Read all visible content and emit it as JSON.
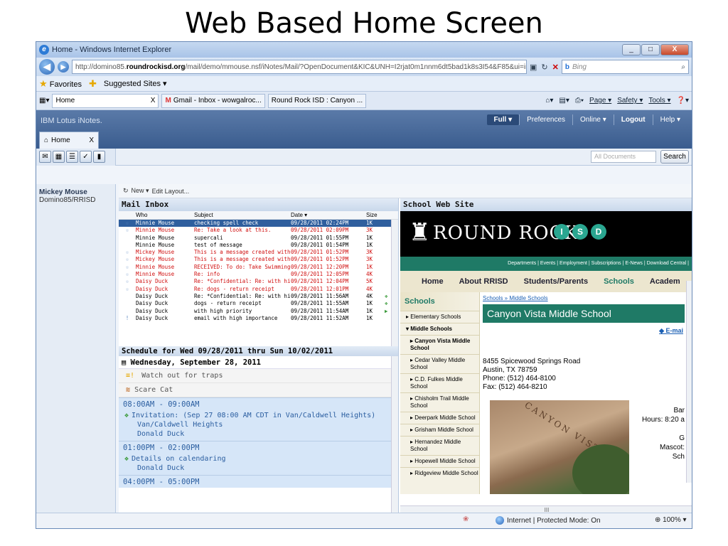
{
  "slide_title": "Web Based Home Screen",
  "browser": {
    "title": "Home - Windows Internet Explorer",
    "window_buttons": {
      "minimize": "_",
      "maximize": "□",
      "close": "X"
    },
    "url_prefix": "http://domino85.",
    "url_domain": "roundrockisd.org",
    "url_rest": "/mail/demo/mmouse.nsf/iNotes/Mail/?OpenDocument&KIC&UNH=I2rjat0m1nnm6dt5bad1k8s3I54&F85&ui=inotes",
    "search_engine": "Bing",
    "search_placeholder": "Bing",
    "favorites_label": "Favorites",
    "suggested_sites": "Suggested Sites ▾",
    "tabs": [
      "Home",
      "Gmail - Inbox - wowgalroc...",
      "Round Rock ISD : Canyon ..."
    ],
    "tab_close": "X",
    "cmd_page": "Page ▾",
    "cmd_safety": "Safety ▾",
    "cmd_tools": "Tools ▾",
    "cmd_help": "❓▾"
  },
  "notes": {
    "brand": "IBM Lotus iNotes.",
    "links": {
      "full": "Full ▾",
      "preferences": "Preferences",
      "online": "Online ▾",
      "logout": "Logout",
      "help": "Help ▾"
    },
    "home_tab": "Home",
    "home_tab_close": "X",
    "search_placeholder": "All Documents",
    "search_button": "Search",
    "user_name": "Mickey Mouse",
    "user_server": "Domino85/RRISD",
    "actions": {
      "new": "New ▾",
      "edit_layout": "Edit Layout..."
    }
  },
  "inbox": {
    "title": "Mail Inbox",
    "columns": {
      "who": "Who",
      "subject": "Subject",
      "date": "Date ▾",
      "size": "Size"
    },
    "rows": [
      {
        "star": "☆",
        "who": "Minnie Mouse",
        "subject": "checking spell check",
        "date": "09/28/2011 02:24PM",
        "size": "1K",
        "att": "",
        "state": "sel"
      },
      {
        "star": "☆",
        "who": "Minnie Mouse",
        "subject": "Re: Take a look at this.",
        "date": "09/28/2011 02:09PM",
        "size": "3K",
        "att": "",
        "state": "red"
      },
      {
        "star": "",
        "who": "Minnie Mouse",
        "subject": "supercali",
        "date": "09/28/2011 01:55PM",
        "size": "1K",
        "att": "",
        "state": ""
      },
      {
        "star": "",
        "who": "Minnie Mouse",
        "subject": "test of message",
        "date": "09/28/2011 01:54PM",
        "size": "1K",
        "att": "",
        "state": ""
      },
      {
        "star": "☆",
        "who": "Mickey Mouse",
        "subject": "This is a message created with Stati",
        "date": "09/28/2011 01:52PM",
        "size": "3K",
        "att": "",
        "state": "red"
      },
      {
        "star": "☆",
        "who": "Mickey Mouse",
        "subject": "This is a message created with Stati",
        "date": "09/28/2011 01:52PM",
        "size": "3K",
        "att": "",
        "state": "red"
      },
      {
        "star": "☆",
        "who": "Minnie Mouse",
        "subject": "RECEIVED: To do: Take Swimming L",
        "date": "09/28/2011 12:20PM",
        "size": "1K",
        "att": "",
        "state": "red"
      },
      {
        "star": "☆",
        "who": "Minnie Mouse",
        "subject": "Re: info",
        "date": "09/28/2011 12:05PM",
        "size": "4K",
        "att": "",
        "state": "red"
      },
      {
        "star": "☆",
        "who": "Daisy Duck",
        "subject": "Re: *Confidential: Re: with high pric",
        "date": "09/28/2011 12:04PM",
        "size": "5K",
        "att": "",
        "state": "red"
      },
      {
        "star": "☆",
        "who": "Daisy Duck",
        "subject": "Re: dogs - return receipt",
        "date": "09/28/2011 12:01PM",
        "size": "4K",
        "att": "",
        "state": "red"
      },
      {
        "star": "",
        "who": "Daisy Duck",
        "subject": "Re: *Confidential: Re: with high pric",
        "date": "09/28/2011 11:56AM",
        "size": "4K",
        "att": "❖",
        "state": ""
      },
      {
        "star": "",
        "who": "Daisy Duck",
        "subject": "dogs - return receipt",
        "date": "09/28/2011 11:55AM",
        "size": "1K",
        "att": "❖",
        "state": ""
      },
      {
        "star": "",
        "who": "Daisy Duck",
        "subject": "with high priority",
        "date": "09/28/2011 11:54AM",
        "size": "1K",
        "att": "▶",
        "state": ""
      },
      {
        "star": "!",
        "who": "Daisy Duck",
        "subject": "email with high importance",
        "date": "09/28/2011 11:52AM",
        "size": "1K",
        "att": "",
        "state": ""
      }
    ]
  },
  "schedule": {
    "title": "Schedule for Wed 09/28/2011 thru Sun 10/02/2011",
    "day": "Wednesday, September 28, 2011",
    "all_day": [
      {
        "icon": "≡!",
        "text": "Watch out for traps"
      },
      {
        "icon": "≋",
        "text": "Scare Cat"
      }
    ],
    "entries": [
      {
        "time": "08:00AM - 09:00AM",
        "lines": [
          "Invitation: (Sep 27 08:00 AM CDT in Van/Caldwell Heights)",
          "Van/Caldwell Heights",
          "Donald Duck"
        ]
      },
      {
        "time": "01:00PM - 02:00PM",
        "lines": [
          "Details on calendaring",
          "Donald Duck"
        ]
      },
      {
        "time": "04:00PM - 05:00PM",
        "lines": []
      }
    ]
  },
  "web": {
    "title": "School Web Site",
    "logo_text": "ROUND ROCK",
    "logo_isd": [
      "I",
      "S",
      "D"
    ],
    "links": "Departments | Events | Employment | Subscriptions | E-News | Download Central |",
    "nav": [
      "Home",
      "About RRISD",
      "Students/Parents",
      "Schools",
      "Academ"
    ],
    "side_header": "Schools",
    "side_items": [
      {
        "label": "▸ Elementary Schools",
        "cls": ""
      },
      {
        "label": "▾ Middle Schools",
        "cls": "bold"
      },
      {
        "label": "▸ Canyon Vista Middle School",
        "cls": "bold indent"
      },
      {
        "label": "▸ Cedar Valley Middle School",
        "cls": "indent"
      },
      {
        "label": "▸ C.D. Fulkes Middle School",
        "cls": "indent"
      },
      {
        "label": "▸ Chisholm Trail Middle School",
        "cls": "indent"
      },
      {
        "label": "▸ Deerpark Middle School",
        "cls": "indent"
      },
      {
        "label": "▸ Grisham Middle School",
        "cls": "indent"
      },
      {
        "label": "▸ Hernandez Middle School",
        "cls": "indent"
      },
      {
        "label": "▸ Hopewell Middle School",
        "cls": "indent"
      },
      {
        "label": "▸ Ridgeview Middle School",
        "cls": "indent"
      }
    ],
    "breadcrumb": "Schools » Middle Schools",
    "school_name": "Canyon Vista Middle School",
    "email_link": "E-mai",
    "address": [
      "8455 Spicewood Springs Road",
      "Austin, TX 78759",
      "Phone: (512) 464-8100",
      "Fax: (512) 464-8210"
    ],
    "photo_sign": "CANYON VISTA",
    "right_info": [
      "Bar",
      "Hours: 8:20 a",
      "",
      "G",
      "Mascot:",
      "Sch"
    ],
    "hscroll_mark": "III"
  },
  "status": {
    "zone": "Internet | Protected Mode: On",
    "zoom": "100% ▾"
  }
}
